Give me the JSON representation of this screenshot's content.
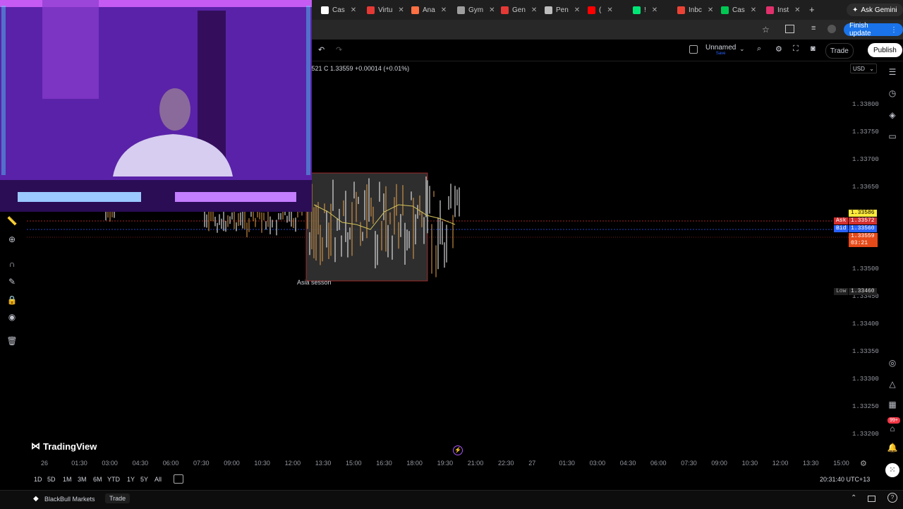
{
  "browser": {
    "tabs": [
      {
        "label": "Cas",
        "color": "#ffffff"
      },
      {
        "label": "Virtu",
        "color": "#e53935"
      },
      {
        "label": "Ana",
        "color": "#ff7043"
      },
      {
        "label": "Gym",
        "color": "#9e9e9e"
      },
      {
        "label": "Gen",
        "color": "#e53935"
      },
      {
        "label": "Pen",
        "color": "#bdbdbd"
      },
      {
        "label": "(",
        "color": "#ff0000"
      },
      {
        "label": "!",
        "color": "#00e676"
      },
      {
        "label": "Inbc",
        "color": "#ea4335"
      },
      {
        "label": "Cas",
        "color": "#00c853"
      },
      {
        "label": "Inst",
        "color": "#e1306c"
      }
    ],
    "ask_gemini": "Ask Gemini",
    "finish_update": "Finish update"
  },
  "toolbar": {
    "layout_name": "Unnamed",
    "layout_sub": "Save",
    "trade": "Trade",
    "publish": "Publish"
  },
  "chart": {
    "ohlc_text": "J521 C 1.33559 +0.00014 (+0.01%)",
    "currency": "USD",
    "watermark": "TradingView",
    "session_label": "Asia sesson",
    "price_ticks": [
      "1.33800",
      "1.33750",
      "1.33700",
      "1.33650",
      "1.33500",
      "1.33450",
      "1.33400",
      "1.33350",
      "1.33300",
      "1.33250",
      "1.33200"
    ],
    "time_ticks": [
      "26",
      "01:30",
      "03:00",
      "04:30",
      "06:00",
      "07:30",
      "09:00",
      "10:30",
      "12:00",
      "13:30",
      "15:00",
      "16:30",
      "18:00",
      "19:30",
      "21:00",
      "22:30",
      "27",
      "01:30",
      "03:00",
      "04:30",
      "06:00",
      "07:30",
      "09:00",
      "10:30",
      "12:00",
      "13:30",
      "15:00"
    ],
    "tags": {
      "high": "1.33586",
      "ask_label": "Ask",
      "ask": "1.33572",
      "bid_label": "Bid",
      "bid": "1.33560",
      "last": "1.33559",
      "countdown": "03:21",
      "low_label": "Low",
      "low": "1.33460"
    },
    "ranges": [
      "1D",
      "5D",
      "1M",
      "3M",
      "6M",
      "YTD",
      "1Y",
      "5Y",
      "All"
    ],
    "clock": "20:31:40 UTC+13"
  },
  "footer": {
    "broker": "BlackBull Markets",
    "trade": "Trade"
  },
  "colors": {
    "ask": "#d32f2f",
    "bid": "#2962ff",
    "last": "#f44336",
    "high": "#ffeb3b",
    "candle": "#e8a24a",
    "ma": "#d4c45a"
  },
  "chart_data": {
    "type": "candlestick",
    "ylim": [
      1.3318,
      1.3382
    ],
    "session_box": {
      "label": "Asia sesson",
      "price_high": 1.33672,
      "price_low": 1.33525
    }
  }
}
